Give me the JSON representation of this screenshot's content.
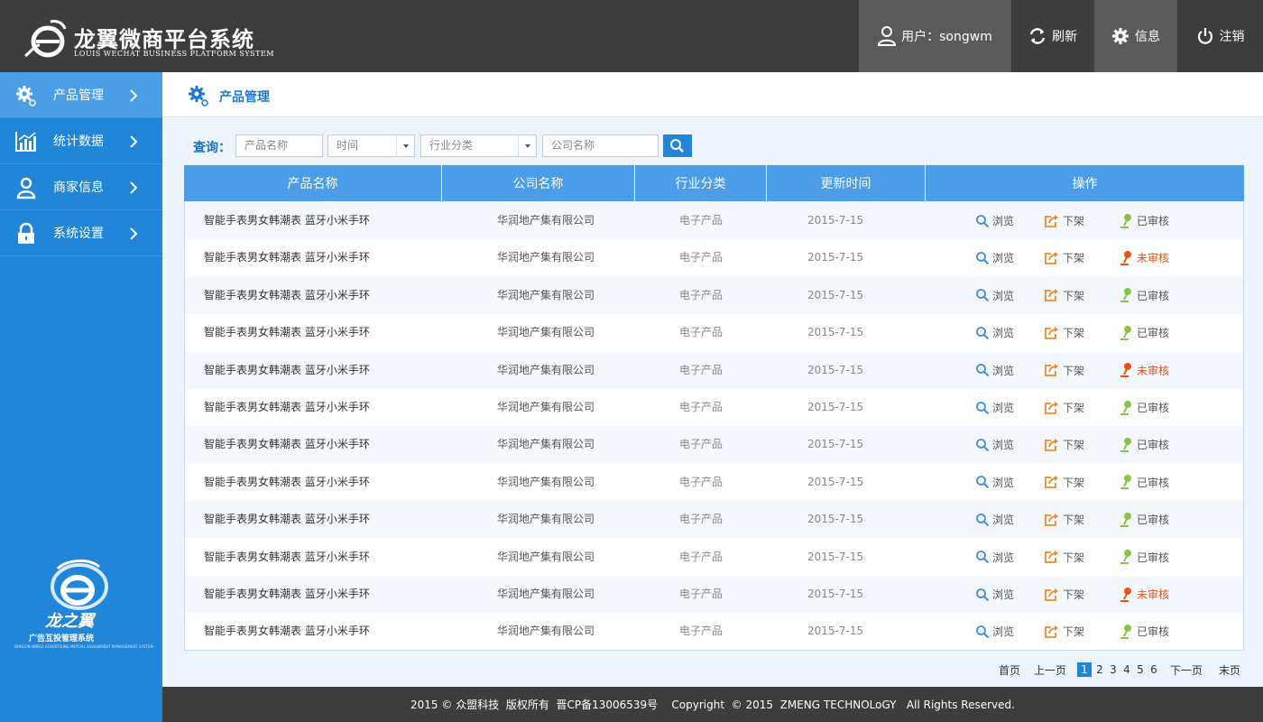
{
  "header": {
    "logo_title": "龙翼微商平台系统",
    "logo_subtitle": "LOUIS WECHAT BUSINESS PLATFORM SYSTEM",
    "user_label": "用户：songwm",
    "refresh_label": "刷新",
    "info_label": "信息",
    "logout_label": "注销"
  },
  "sidebar": {
    "items": [
      {
        "label": "产品管理",
        "icon": "gear-icon",
        "active": true
      },
      {
        "label": "统计数据",
        "icon": "bar-chart-icon"
      },
      {
        "label": "商家信息",
        "icon": "user-icon"
      },
      {
        "label": "系统设置",
        "icon": "lock-icon"
      }
    ],
    "logo_title": "龙之翼",
    "logo_subtitle": "广告互投管理系统",
    "logo_english": "DRAGON WINGS ADVERTISING MUTUAL ASSIGNMENT MANAGEMENT SYSTEM"
  },
  "page": {
    "title": "产品管理"
  },
  "query": {
    "label": "查询：",
    "product_placeholder": "产品名称",
    "time_placeholder": "时间",
    "category_placeholder": "行业分类",
    "company_placeholder": "公司名称"
  },
  "table": {
    "columns": [
      "产品名称",
      "公司名称",
      "行业分类",
      "更新时间",
      "操作"
    ],
    "actions": {
      "view": "浏览",
      "offline": "下架"
    },
    "rows": [
      {
        "name": "智能手表男女韩潮表 蓝牙小米手环",
        "company": "华润地产集有限公司",
        "category": "电子产品",
        "date": "2015-7-15",
        "status": "已审核",
        "approved": true
      },
      {
        "name": "智能手表男女韩潮表 蓝牙小米手环",
        "company": "华润地产集有限公司",
        "category": "电子产品",
        "date": "2015-7-15",
        "status": "未审核",
        "approved": false
      },
      {
        "name": "智能手表男女韩潮表 蓝牙小米手环",
        "company": "华润地产集有限公司",
        "category": "电子产品",
        "date": "2015-7-15",
        "status": "已审核",
        "approved": true
      },
      {
        "name": "智能手表男女韩潮表 蓝牙小米手环",
        "company": "华润地产集有限公司",
        "category": "电子产品",
        "date": "2015-7-15",
        "status": "已审核",
        "approved": true
      },
      {
        "name": "智能手表男女韩潮表 蓝牙小米手环",
        "company": "华润地产集有限公司",
        "category": "电子产品",
        "date": "2015-7-15",
        "status": "未审核",
        "approved": false
      },
      {
        "name": "智能手表男女韩潮表 蓝牙小米手环",
        "company": "华润地产集有限公司",
        "category": "电子产品",
        "date": "2015-7-15",
        "status": "已审核",
        "approved": true
      },
      {
        "name": "智能手表男女韩潮表 蓝牙小米手环",
        "company": "华润地产集有限公司",
        "category": "电子产品",
        "date": "2015-7-15",
        "status": "已审核",
        "approved": true
      },
      {
        "name": "智能手表男女韩潮表 蓝牙小米手环",
        "company": "华润地产集有限公司",
        "category": "电子产品",
        "date": "2015-7-15",
        "status": "已审核",
        "approved": true
      },
      {
        "name": "智能手表男女韩潮表 蓝牙小米手环",
        "company": "华润地产集有限公司",
        "category": "电子产品",
        "date": "2015-7-15",
        "status": "已审核",
        "approved": true
      },
      {
        "name": "智能手表男女韩潮表 蓝牙小米手环",
        "company": "华润地产集有限公司",
        "category": "电子产品",
        "date": "2015-7-15",
        "status": "已审核",
        "approved": true
      },
      {
        "name": "智能手表男女韩潮表 蓝牙小米手环",
        "company": "华润地产集有限公司",
        "category": "电子产品",
        "date": "2015-7-15",
        "status": "未审核",
        "approved": false
      },
      {
        "name": "智能手表男女韩潮表 蓝牙小米手环",
        "company": "华润地产集有限公司",
        "category": "电子产品",
        "date": "2015-7-15",
        "status": "已审核",
        "approved": true
      }
    ]
  },
  "pagination": {
    "first": "首页",
    "prev": "上一页",
    "pages": [
      "1",
      "2",
      "3",
      "4",
      "5",
      "6"
    ],
    "current": "1",
    "next": "下一页",
    "last": "末页"
  },
  "footer": {
    "text": "2015 © 众盟科技  版权所有  晋CP备13006539号    Copyright  © 2015  ZMENG TECHNOLoGY   All Rights Reserved."
  },
  "colors": {
    "header_bg": "#3d3d3d",
    "sidebar_bg": "#2185d8",
    "table_header_bg": "#4a9de6",
    "approved": "#8bc34a",
    "pending": "#e85317",
    "action_orange": "#f08a24"
  }
}
